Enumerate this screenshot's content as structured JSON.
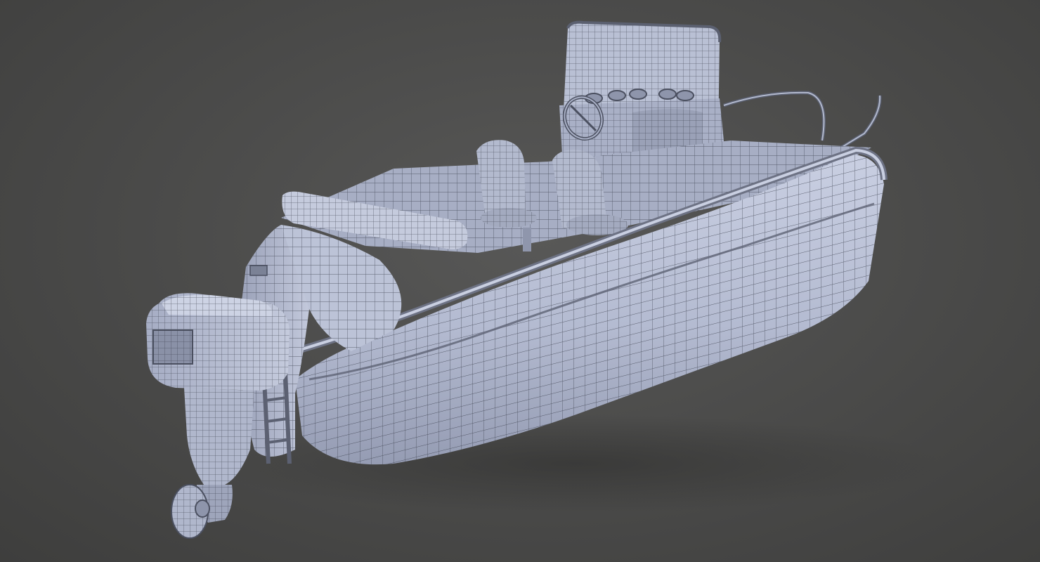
{
  "scene": {
    "subject": "boat-wireframe-render",
    "background_color": "#4a4a49",
    "mesh_fill_color": "#bac1d6",
    "mesh_shade_color": "#8d94aa",
    "wire_color": "#3b3f4c",
    "shadow_color": "#333332"
  }
}
